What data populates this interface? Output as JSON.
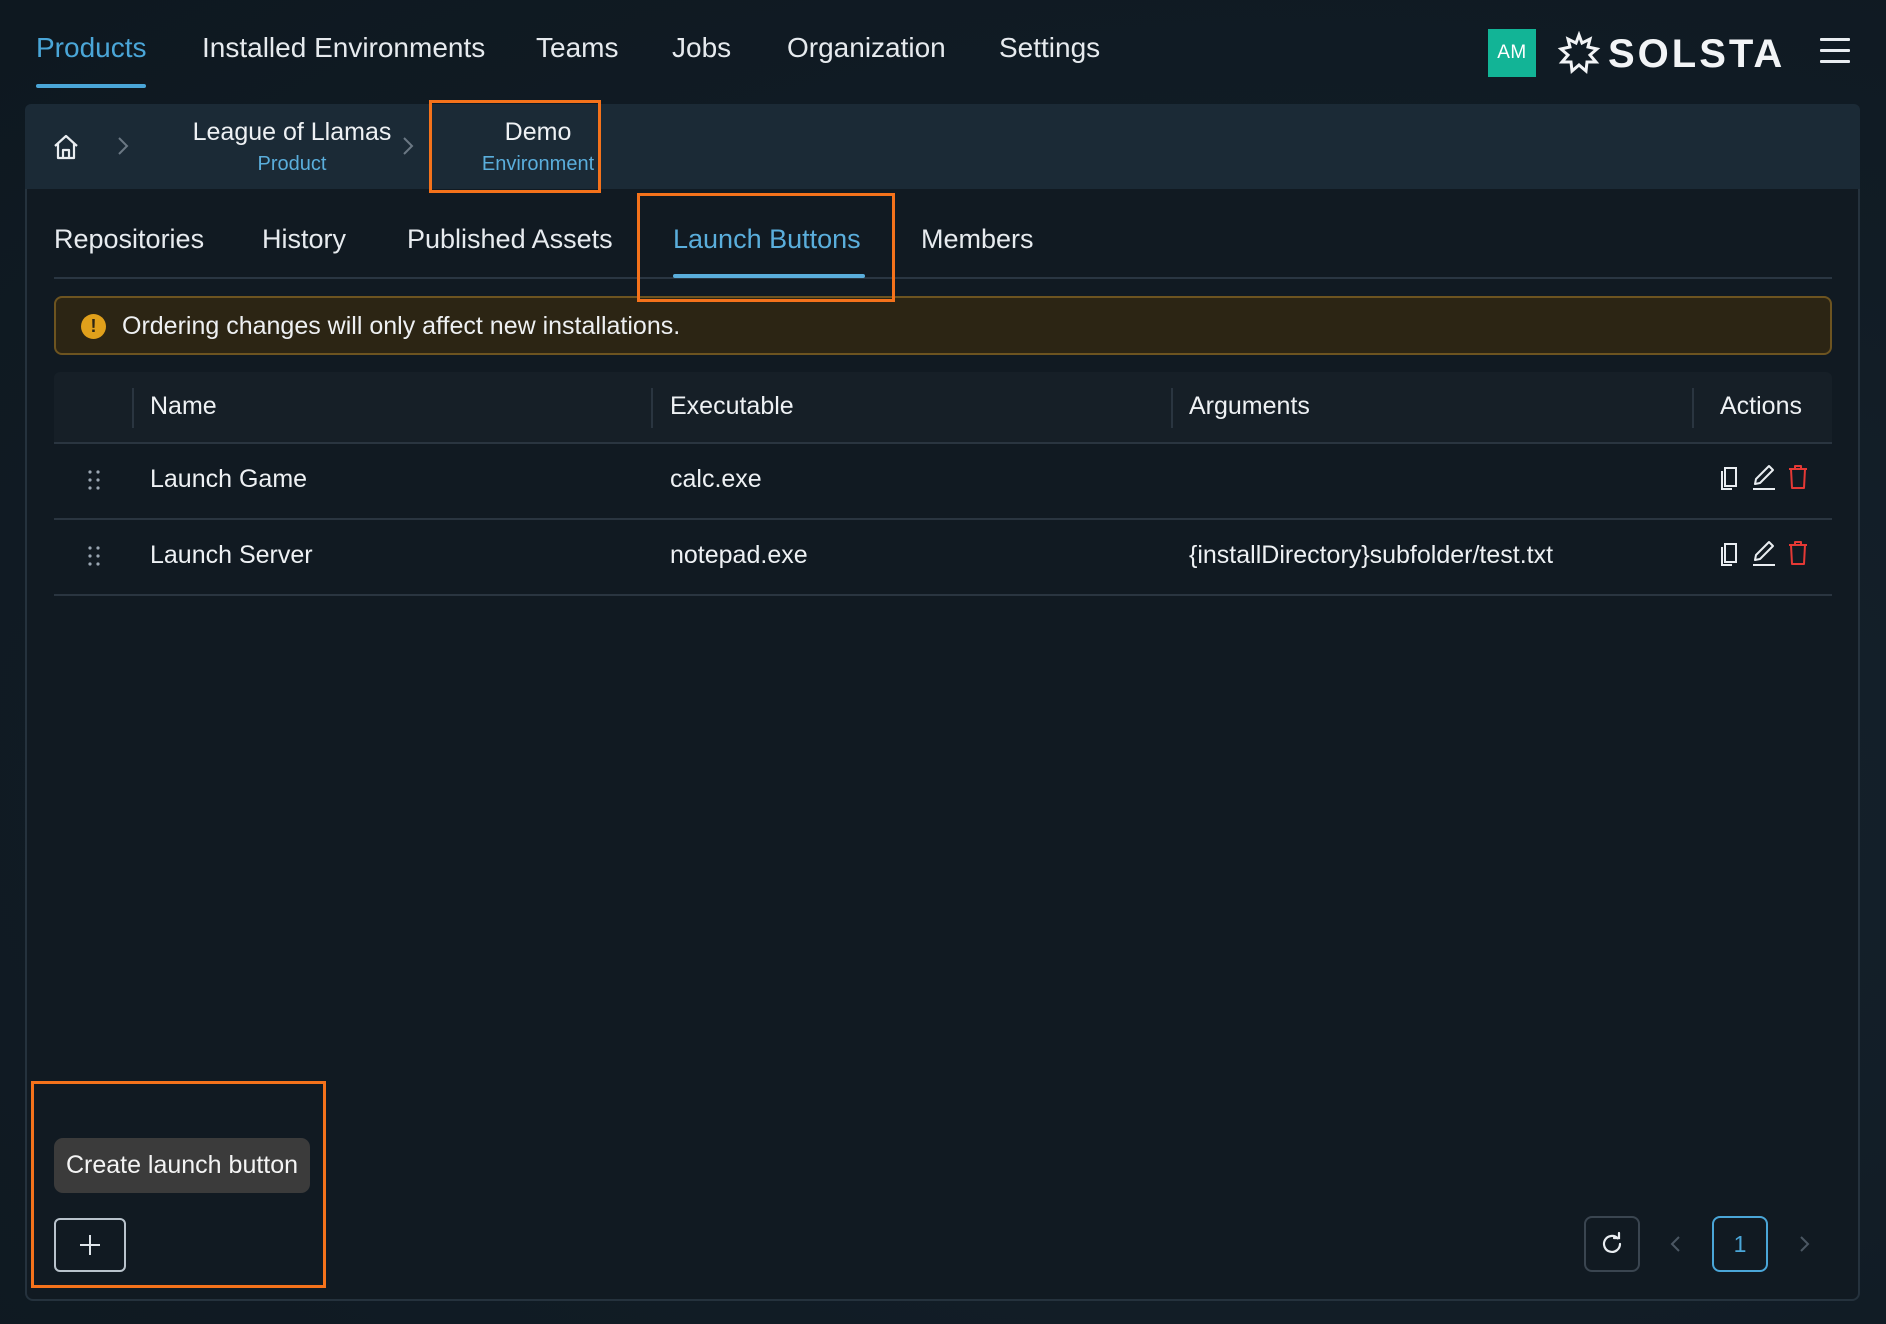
{
  "nav": {
    "items": [
      {
        "label": "Products",
        "active": true
      },
      {
        "label": "Installed Environments"
      },
      {
        "label": "Teams"
      },
      {
        "label": "Jobs"
      },
      {
        "label": "Organization"
      },
      {
        "label": "Settings"
      }
    ],
    "avatar_initials": "AM",
    "logo_text": "SOLSTA",
    "icons": {
      "menu": "hamburger-menu-icon",
      "logo": "solsta-logo-icon"
    }
  },
  "breadcrumb": {
    "home_icon": "home-icon",
    "items": [
      {
        "title": "League of Llamas",
        "subtitle": "Product"
      },
      {
        "title": "Demo",
        "subtitle": "Environment"
      }
    ]
  },
  "tabs": [
    {
      "label": "Repositories"
    },
    {
      "label": "History"
    },
    {
      "label": "Published Assets"
    },
    {
      "label": "Launch Buttons",
      "active": true
    },
    {
      "label": "Members"
    }
  ],
  "alert": {
    "text": "Ordering changes will only affect new installations.",
    "icon": "warning-icon",
    "color": "#e0a01b"
  },
  "table": {
    "columns": [
      "Name",
      "Executable",
      "Arguments",
      "Actions"
    ],
    "rows": [
      {
        "name": "Launch Game",
        "executable": "calc.exe",
        "arguments": ""
      },
      {
        "name": "Launch Server",
        "executable": "notepad.exe",
        "arguments": "{installDirectory}subfolder/test.txt"
      }
    ],
    "action_icons": [
      "copy-icon",
      "edit-icon",
      "delete-icon"
    ]
  },
  "footer": {
    "create_tooltip": "Create launch button",
    "add_icon": "plus-icon",
    "refresh_icon": "refresh-icon",
    "current_page": "1"
  },
  "colors": {
    "accent": "#4aa6d8",
    "highlight": "#f5721b",
    "avatar": "#12b496",
    "delete": "#e53935"
  }
}
